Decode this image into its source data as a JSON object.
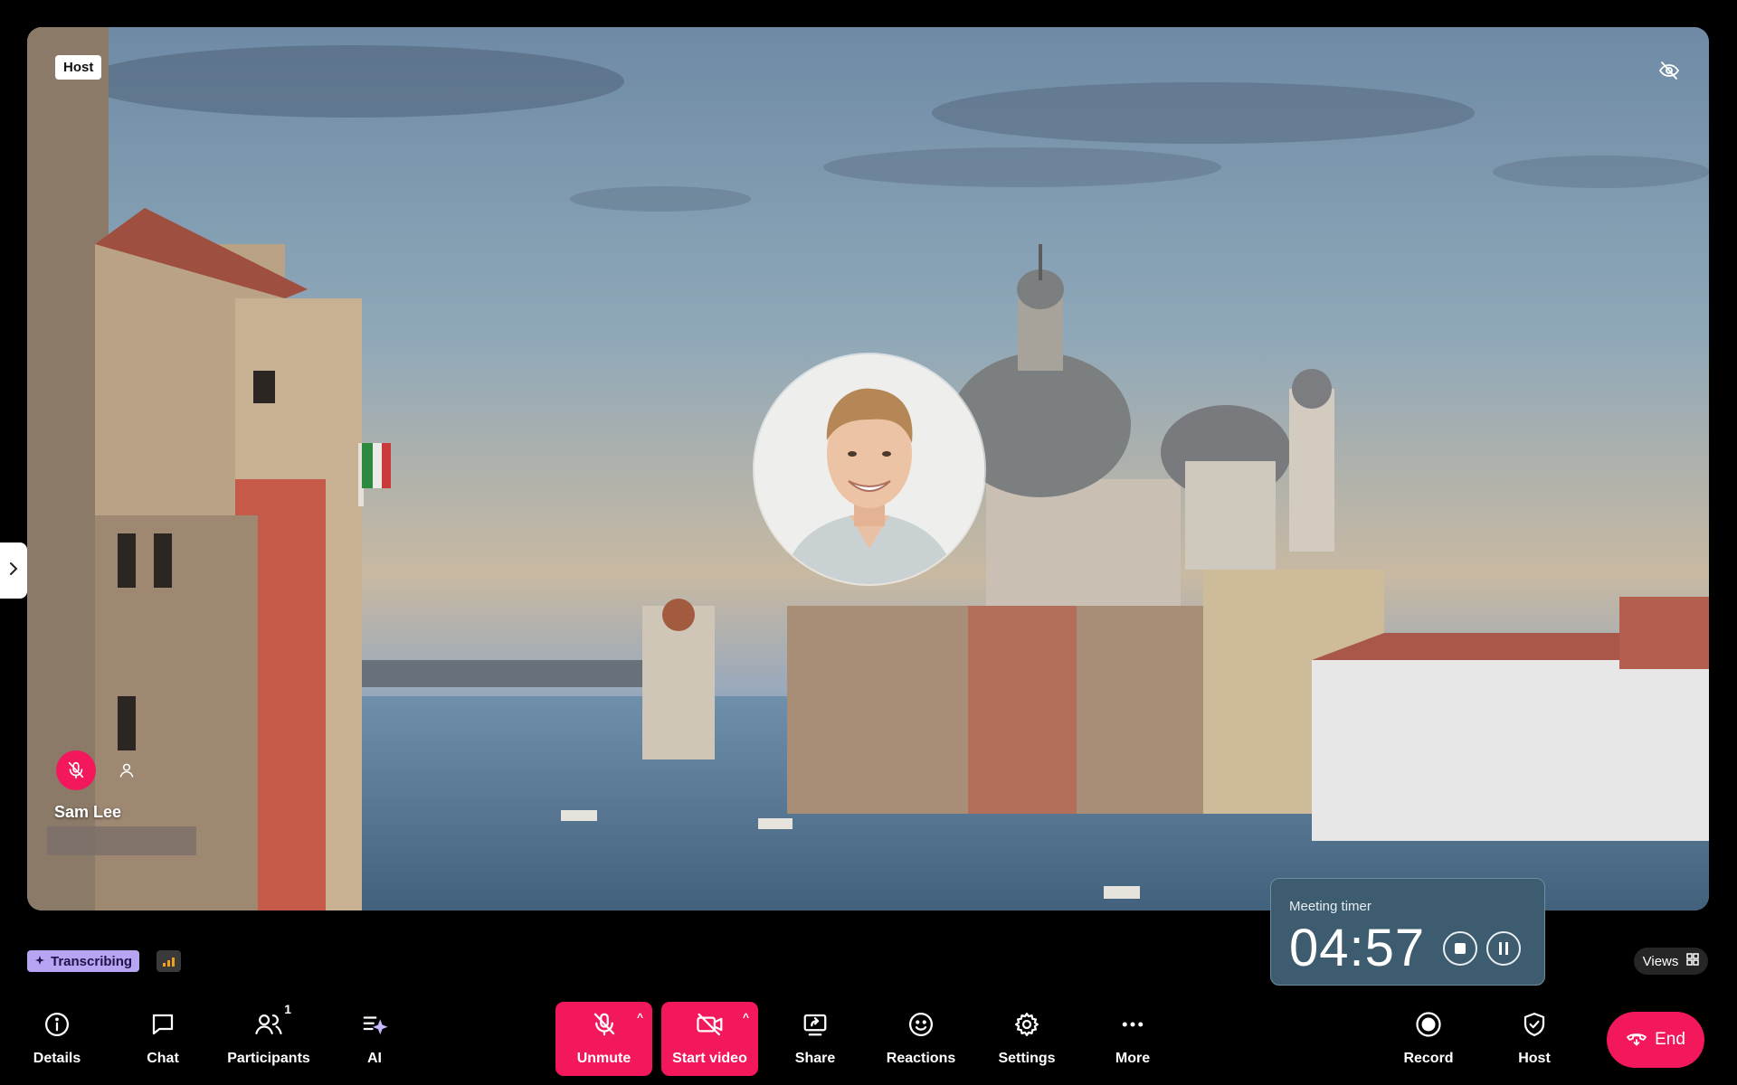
{
  "stage": {
    "host_tag": "Host",
    "participant_name": "Sam Lee"
  },
  "timer": {
    "title": "Meeting timer",
    "value": "04:57"
  },
  "status": {
    "transcribing_label": "Transcribing",
    "views_label": "Views"
  },
  "toolbar": {
    "details": "Details",
    "chat": "Chat",
    "participants": "Participants",
    "participants_count": "1",
    "ai": "AI",
    "unmute": "Unmute",
    "start_video": "Start video",
    "share": "Share",
    "reactions": "Reactions",
    "settings": "Settings",
    "more": "More",
    "record": "Record",
    "host": "Host",
    "end": "End"
  },
  "colors": {
    "accent_red": "#f2185b",
    "timer_bg": "#3e5c6f",
    "transcribing_bg": "#b7a4f2"
  },
  "icons": {
    "details": "info-icon",
    "chat": "chat-bubble-icon",
    "participants": "people-icon",
    "ai": "ai-sparkle-icon",
    "unmute": "mic-off-icon",
    "start_video": "video-off-icon",
    "share": "share-screen-icon",
    "reactions": "smiley-icon",
    "settings": "gear-icon",
    "more": "ellipsis-icon",
    "record": "record-icon",
    "host": "shield-check-icon",
    "end": "hang-up-icon"
  }
}
